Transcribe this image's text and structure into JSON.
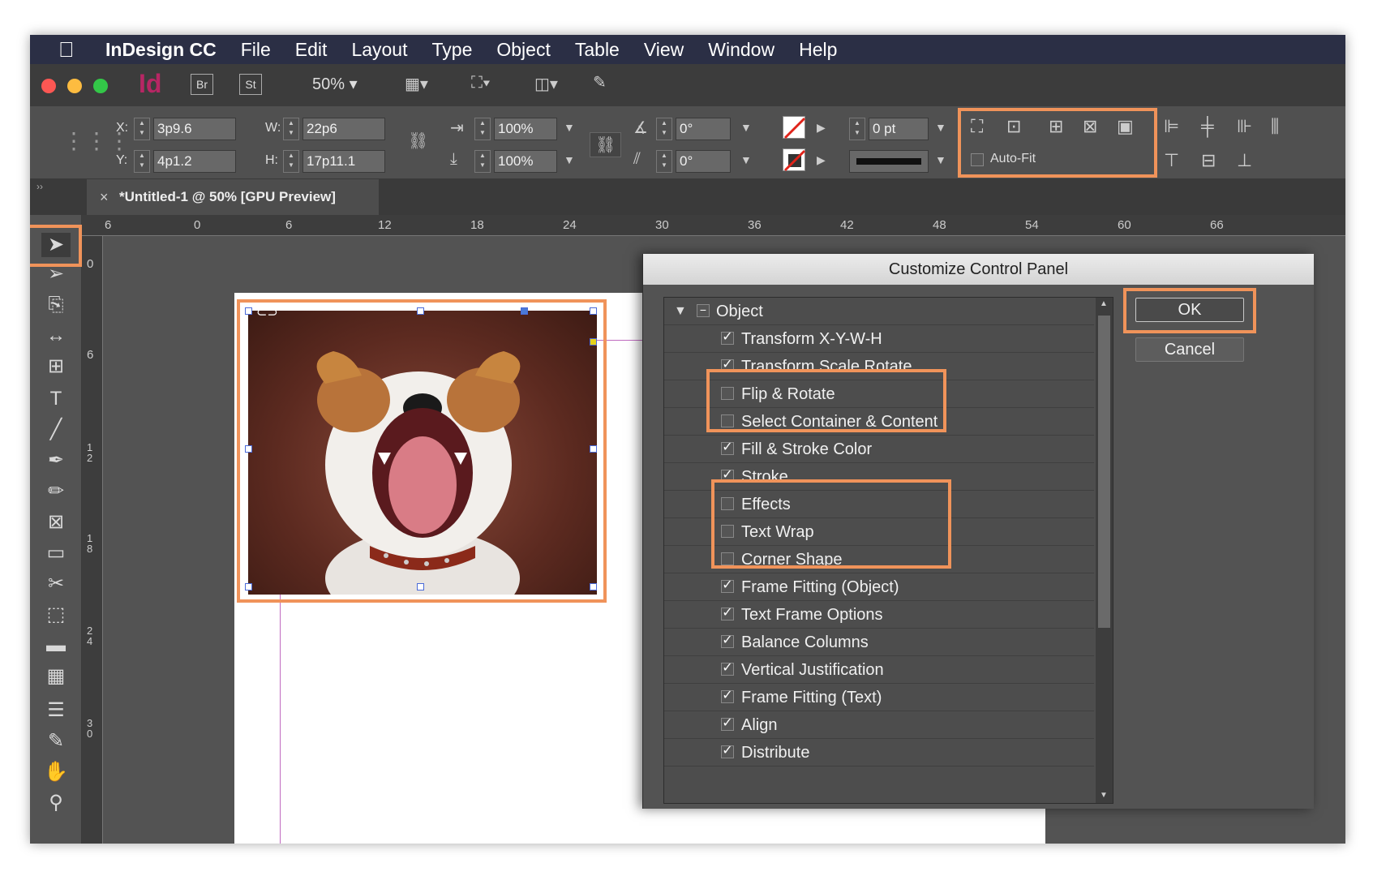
{
  "menubar": {
    "app_name": "InDesign CC",
    "items": [
      "File",
      "Edit",
      "Layout",
      "Type",
      "Object",
      "Table",
      "View",
      "Window",
      "Help"
    ]
  },
  "appbar": {
    "logo": "Id",
    "bridge_label": "Br",
    "stock_label": "St",
    "zoom": "50%"
  },
  "control_panel": {
    "x_label": "X:",
    "x_value": "3p9.6",
    "y_label": "Y:",
    "y_value": "4p1.2",
    "w_label": "W:",
    "w_value": "22p6",
    "h_label": "H:",
    "h_value": "17p11.1",
    "scale_x": "100%",
    "scale_y": "100%",
    "rotate": "0°",
    "shear": "0°",
    "stroke_weight": "0 pt",
    "auto_fit_label": "Auto-Fit",
    "highlight_color": "#f0935a"
  },
  "tab": {
    "close": "×",
    "title": "*Untitled-1 @ 50% [GPU Preview]"
  },
  "ruler": {
    "h_ticks": [
      "6",
      "0",
      "6",
      "12",
      "18",
      "24",
      "30",
      "36",
      "42",
      "48",
      "54",
      "60",
      "66"
    ],
    "v_ticks": [
      "0",
      "6",
      "12",
      "18",
      "24",
      "30"
    ]
  },
  "dialog": {
    "title": "Customize Control Panel",
    "ok_label": "OK",
    "cancel_label": "Cancel",
    "group_label": "Object",
    "items": [
      {
        "label": "Transform X-Y-W-H",
        "checked": "✓"
      },
      {
        "label": "Transform Scale Rotate",
        "checked": "✓"
      },
      {
        "label": "Flip & Rotate",
        "checked": ""
      },
      {
        "label": "Select Container & Content",
        "checked": ""
      },
      {
        "label": "Fill & Stroke Color",
        "checked": "✓"
      },
      {
        "label": "Stroke",
        "checked": "✓"
      },
      {
        "label": "Effects",
        "checked": ""
      },
      {
        "label": "Text Wrap",
        "checked": ""
      },
      {
        "label": "Corner Shape",
        "checked": ""
      },
      {
        "label": "Frame Fitting (Object)",
        "checked": "✓"
      },
      {
        "label": "Text Frame Options",
        "checked": "✓"
      },
      {
        "label": "Balance Columns",
        "checked": "✓"
      },
      {
        "label": "Vertical Justification",
        "checked": "✓"
      },
      {
        "label": "Frame Fitting (Text)",
        "checked": "✓"
      },
      {
        "label": "Align",
        "checked": "✓"
      },
      {
        "label": "Distribute",
        "checked": "✓"
      }
    ]
  }
}
